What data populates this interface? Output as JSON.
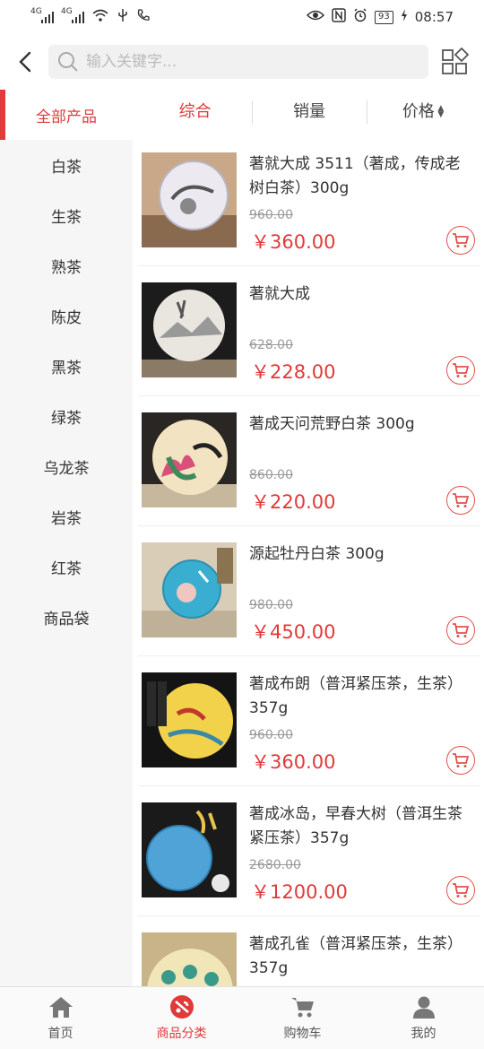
{
  "status_bar": {
    "time": "08:57",
    "battery": "93",
    "net1": "4G",
    "net2": "4G"
  },
  "search": {
    "placeholder": "输入关键字..."
  },
  "sidebar": {
    "items": [
      {
        "label": "全部产品"
      },
      {
        "label": "白茶"
      },
      {
        "label": "生茶"
      },
      {
        "label": "熟茶"
      },
      {
        "label": "陈皮"
      },
      {
        "label": "黑茶"
      },
      {
        "label": "绿茶"
      },
      {
        "label": "乌龙茶"
      },
      {
        "label": "岩茶"
      },
      {
        "label": "红茶"
      },
      {
        "label": "商品袋"
      }
    ]
  },
  "sort": {
    "tabs": [
      {
        "label": "综合"
      },
      {
        "label": "销量"
      },
      {
        "label": "价格"
      }
    ]
  },
  "products": [
    {
      "name": "著就大成 3511（著成，传成老树白茶）300g",
      "old_price": "960.00",
      "price": "￥360.00"
    },
    {
      "name": "著就大成",
      "old_price": "628.00",
      "price": "￥228.00"
    },
    {
      "name": "著成天问荒野白茶 300g",
      "old_price": "860.00",
      "price": "￥220.00"
    },
    {
      "name": "源起牡丹白茶 300g",
      "old_price": "980.00",
      "price": "￥450.00"
    },
    {
      "name": "著成布朗（普洱紧压茶，生茶） 357g",
      "old_price": "960.00",
      "price": "￥360.00"
    },
    {
      "name": "著成冰岛，早春大树（普洱生茶紧压茶）357g",
      "old_price": "2680.00",
      "price": "￥1200.00"
    },
    {
      "name": "著成孔雀（普洱紧压茶，生茶） 357g",
      "old_price": "",
      "price": ""
    }
  ],
  "tab_bar": {
    "items": [
      {
        "label": "首页"
      },
      {
        "label": "商品分类"
      },
      {
        "label": "购物车"
      },
      {
        "label": "我的"
      }
    ]
  },
  "colors": {
    "accent": "#e03a3a",
    "sidebar_bg": "#f6f6f6"
  },
  "icons": {
    "back": "chevron-left-icon",
    "search": "search-icon",
    "grid": "grid-icon",
    "cart": "cart-icon"
  }
}
